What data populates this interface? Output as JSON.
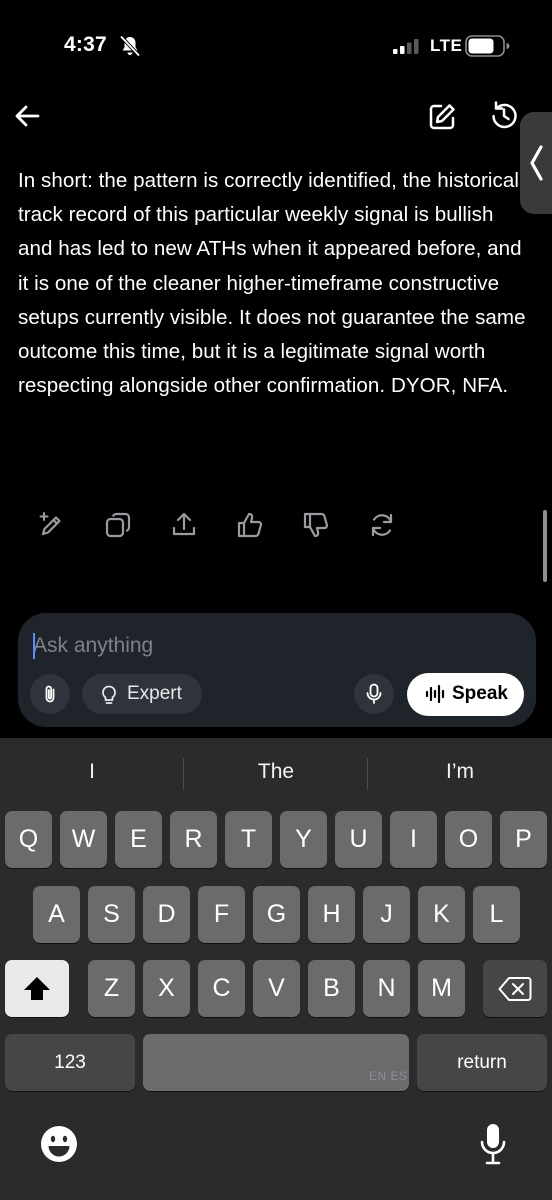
{
  "status_bar": {
    "time": "4:37",
    "network": "LTE",
    "icons": [
      "bell-slash-icon",
      "signal-icon",
      "battery-icon"
    ]
  },
  "top_bar": {
    "icons": [
      "back-arrow-icon",
      "new-chat-icon",
      "history-icon",
      "chevron-left-icon"
    ]
  },
  "message": {
    "text": "In short: the pattern is correctly identified, the historical track record of this particular weekly signal is bullish and has led to new ATHs when it appeared before, and it is one of the cleaner higher-timeframe constructive setups currently visible. It does not guarantee the same outcome this time, but it is a legitimate signal worth respecting alongside other confirmation. DYOR, NFA."
  },
  "message_actions": [
    "edit-sparkle-icon",
    "copy-icon",
    "share-icon",
    "thumbs-up-icon",
    "thumbs-down-icon",
    "regenerate-icon"
  ],
  "composer": {
    "placeholder": "Ask anything",
    "expert_label": "Expert",
    "speak_label": "Speak",
    "icons": [
      "paperclip-icon",
      "lightbulb-icon",
      "mic-icon",
      "waveform-icon"
    ]
  },
  "keyboard": {
    "suggestions": [
      "I",
      "The",
      "I’m"
    ],
    "row1": [
      "Q",
      "W",
      "E",
      "R",
      "T",
      "Y",
      "U",
      "I",
      "O",
      "P"
    ],
    "row2": [
      "A",
      "S",
      "D",
      "F",
      "G",
      "H",
      "J",
      "K",
      "L"
    ],
    "row3": [
      "Z",
      "X",
      "C",
      "V",
      "B",
      "N",
      "M"
    ],
    "numbers_label": "123",
    "return_label": "return",
    "languages_label": "EN ES",
    "icons": [
      "shift-icon",
      "backspace-icon",
      "emoji-icon",
      "dictation-mic-icon"
    ]
  },
  "colors": {
    "background": "#000000",
    "composer_bg": "#1f232a",
    "keyboard_bg": "#2b2b2d",
    "key_bg": "#6b6b6e",
    "caret": "#5b8cff"
  }
}
